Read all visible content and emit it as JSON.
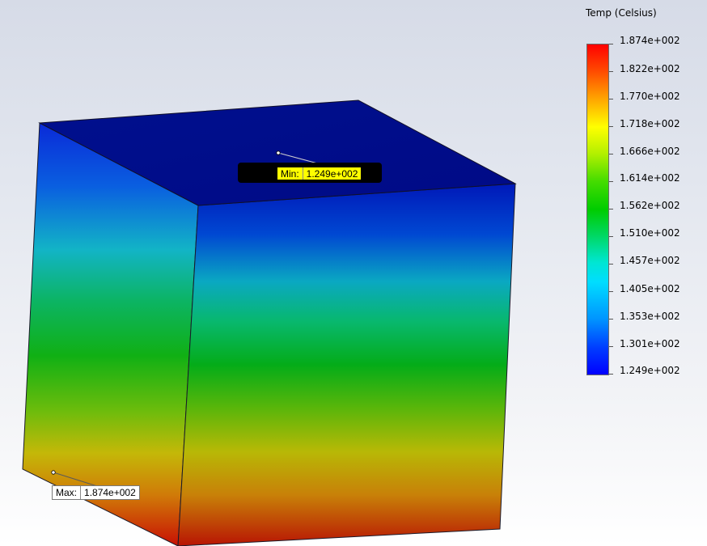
{
  "legend": {
    "title": "Temp (Celsius)",
    "labels": [
      "1.874e+002",
      "1.822e+002",
      "1.770e+002",
      "1.718e+002",
      "1.666e+002",
      "1.614e+002",
      "1.562e+002",
      "1.510e+002",
      "1.457e+002",
      "1.405e+002",
      "1.353e+002",
      "1.301e+002",
      "1.249e+002"
    ],
    "max_color": "#ff0000",
    "min_color": "#0000ff"
  },
  "probes": {
    "min": {
      "label": "Min:",
      "value": "1.249e+002"
    },
    "max": {
      "label": "Max:",
      "value": "1.874e+002"
    }
  },
  "palette": {
    "top_face": "#000a8a",
    "background": "#e3e7ef"
  }
}
